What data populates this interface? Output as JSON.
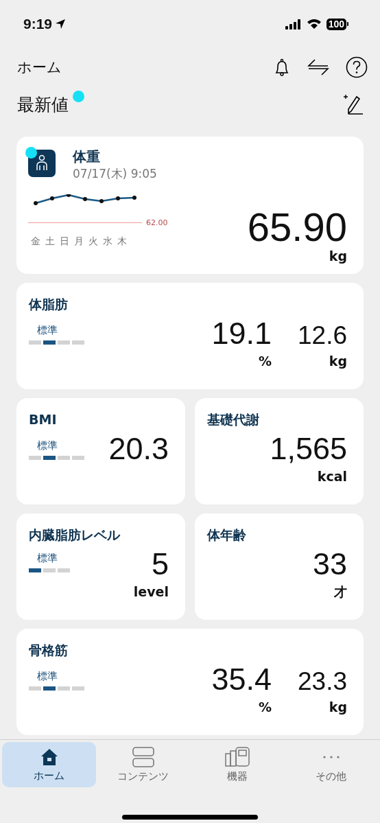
{
  "status_bar": {
    "time": "9:19",
    "battery": "100"
  },
  "header": {
    "title": "ホーム"
  },
  "section": {
    "title": "最新値",
    "new": true
  },
  "weight": {
    "title": "体重",
    "new": true,
    "date": "07/17(木) 9:05",
    "reference": "62.00",
    "days": [
      "金",
      "土",
      "日",
      "月",
      "火",
      "水",
      "木"
    ],
    "value": "65.90",
    "unit": "kg"
  },
  "metrics": [
    {
      "kind": "wide",
      "title": "体脂肪",
      "status": "標準",
      "scale": [
        {
          "on": false
        },
        {
          "on": true
        },
        {
          "on": false
        },
        {
          "on": false
        }
      ],
      "readings": [
        {
          "value": "19.1",
          "unit": "%"
        },
        {
          "value": "12.6",
          "unit": "kg"
        }
      ]
    },
    {
      "kind": "half",
      "title": "BMI",
      "status": "標準",
      "scale": [
        {
          "on": false
        },
        {
          "on": true
        },
        {
          "on": false
        },
        {
          "on": false
        }
      ],
      "readings": [
        {
          "value": "20.3"
        }
      ]
    },
    {
      "kind": "half",
      "title": "基礎代謝",
      "readings": [
        {
          "value": "1,565",
          "unit": "kcal"
        }
      ]
    },
    {
      "kind": "half",
      "title": "内臓脂肪レベル",
      "status": "標準",
      "scale": [
        {
          "on": true
        },
        {
          "on": false
        },
        {
          "on": false
        }
      ],
      "readings": [
        {
          "value": "5",
          "unit": "level"
        }
      ]
    },
    {
      "kind": "half",
      "title": "体年齢",
      "readings": [
        {
          "value": "33",
          "unit": "才"
        }
      ]
    },
    {
      "kind": "wide",
      "title": "骨格筋",
      "status": "標準",
      "scale": [
        {
          "on": false
        },
        {
          "on": true
        },
        {
          "on": false
        },
        {
          "on": false
        }
      ],
      "readings": [
        {
          "value": "35.4",
          "unit": "%"
        },
        {
          "value": "23.3",
          "unit": "kg"
        }
      ]
    }
  ],
  "tabs": [
    {
      "label": "ホーム",
      "selected": true
    },
    {
      "label": "コンテンツ",
      "selected": false
    },
    {
      "label": "機器",
      "selected": false
    },
    {
      "label": "その他",
      "selected": false
    }
  ]
}
